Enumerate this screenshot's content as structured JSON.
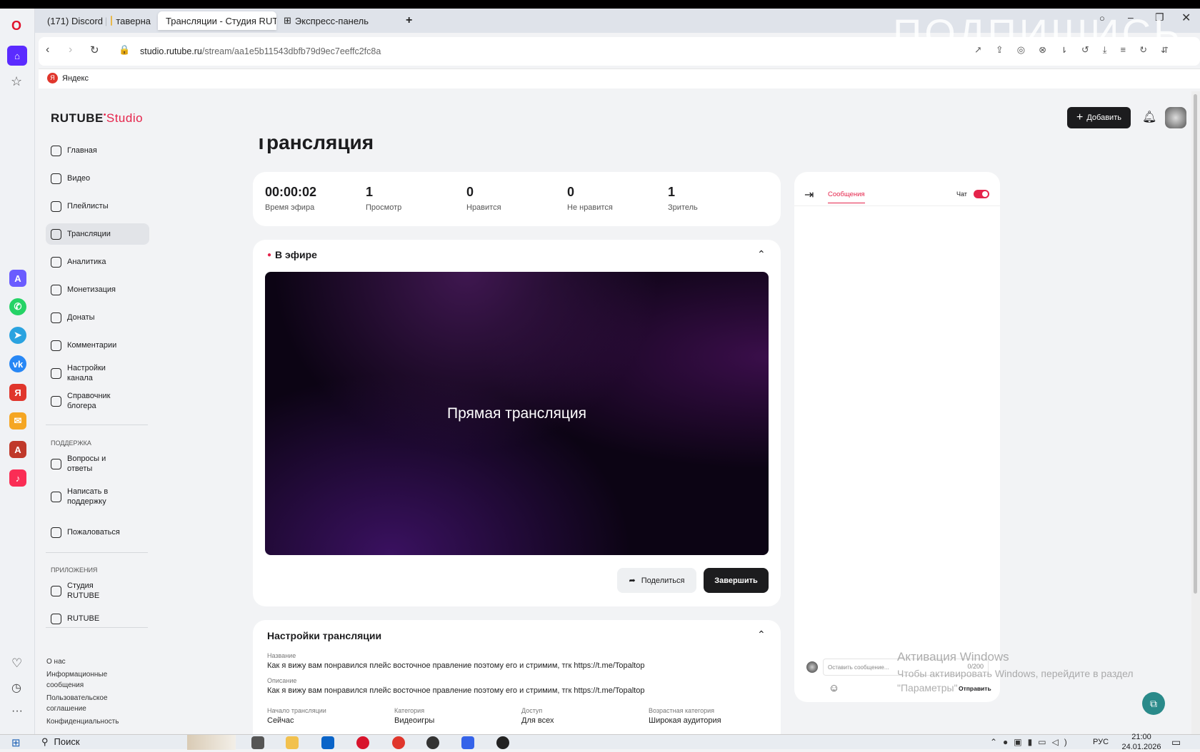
{
  "browser": {
    "tabs": [
      {
        "label": "(171) Discord | ",
        "badge": "171"
      },
      {
        "label": "таверна"
      },
      {
        "label": "Трансляции - Студия RUT"
      },
      {
        "label": "Экспресс-панель"
      }
    ],
    "new_tab": "+",
    "url_domain": "studio.rutube.ru",
    "url_path": "/stream/aa1e5b11543dbfb79d9ec7eeffc2fc8a",
    "bookmarks": [
      {
        "label": "Яндекс"
      }
    ],
    "overlay_text": "ПОДПИШИСЬ"
  },
  "app": {
    "logo": "RUTUBE",
    "logo_suffix": "Studio",
    "add_button": "Добавить",
    "nav": [
      {
        "label": "Главная"
      },
      {
        "label": "Видео"
      },
      {
        "label": "Плейлисты"
      },
      {
        "label": "Трансляции"
      },
      {
        "label": "Аналитика"
      },
      {
        "label": "Монетизация"
      },
      {
        "label": "Донаты"
      },
      {
        "label": "Комментарии"
      },
      {
        "label": "Настройки канала"
      },
      {
        "label": "Справочник блогера"
      }
    ],
    "support_heading": "ПОДДЕРЖКА",
    "support": [
      {
        "label": "Вопросы и ответы"
      },
      {
        "label": "Написать в поддержку"
      },
      {
        "label": "Пожаловаться"
      }
    ],
    "apps_heading": "ПРИЛОЖЕНИЯ",
    "apps": [
      {
        "label": "Студия RUTUBE"
      },
      {
        "label": "RUTUBE"
      }
    ],
    "footer_links": [
      "О нас",
      "Информационные сообщения",
      "Пользовательское соглашение",
      "Конфиденциальность"
    ],
    "page_title": "Трансляция",
    "stats": [
      {
        "value": "00:00:02",
        "label": "Время эфира"
      },
      {
        "value": "1",
        "label": "Просмотр"
      },
      {
        "value": "0",
        "label": "Нравится"
      },
      {
        "value": "0",
        "label": "Не нравится"
      },
      {
        "value": "1",
        "label": "Зритель"
      }
    ],
    "live_label": "В эфире",
    "video_text": "Прямая трансляция",
    "share_button": "Поделиться",
    "finish_button": "Завершить",
    "settings": {
      "title": "Настройки трансляции",
      "name_label": "Название",
      "name": "Как я вижу вам понравился плейс восточное правление поэтому его и стримим, тгк https://t.me/Topaltop",
      "desc_label": "Описание",
      "desc": "Как я вижу вам понравился плейс восточное правление поэтому его и стримим, тгк https://t.me/Topaltop",
      "fields": [
        {
          "label": "Начало трансляции",
          "value": "Сейчас"
        },
        {
          "label": "Категория",
          "value": "Видеоигры"
        },
        {
          "label": "Доступ",
          "value": "Для всех"
        },
        {
          "label": "Возрастная категория",
          "value": "Широкая аудитория"
        }
      ]
    },
    "chat": {
      "tab": "Сообщения",
      "toggle_label": "Чат",
      "toggle_on": true,
      "placeholder": "Оставить сообщение...",
      "counter": "0/200",
      "send": "Отправить"
    }
  },
  "windows": {
    "watermark_title": "Активация Windows",
    "watermark_text": "Чтобы активировать Windows, перейдите в раздел",
    "watermark_text2": "\"Параметры\"",
    "search": "Поиск",
    "lang": "РУС",
    "time": "21:00",
    "date": "24.01.2026"
  },
  "colors": {
    "accent": "#e5244b",
    "dark": "#1c1c1e"
  }
}
